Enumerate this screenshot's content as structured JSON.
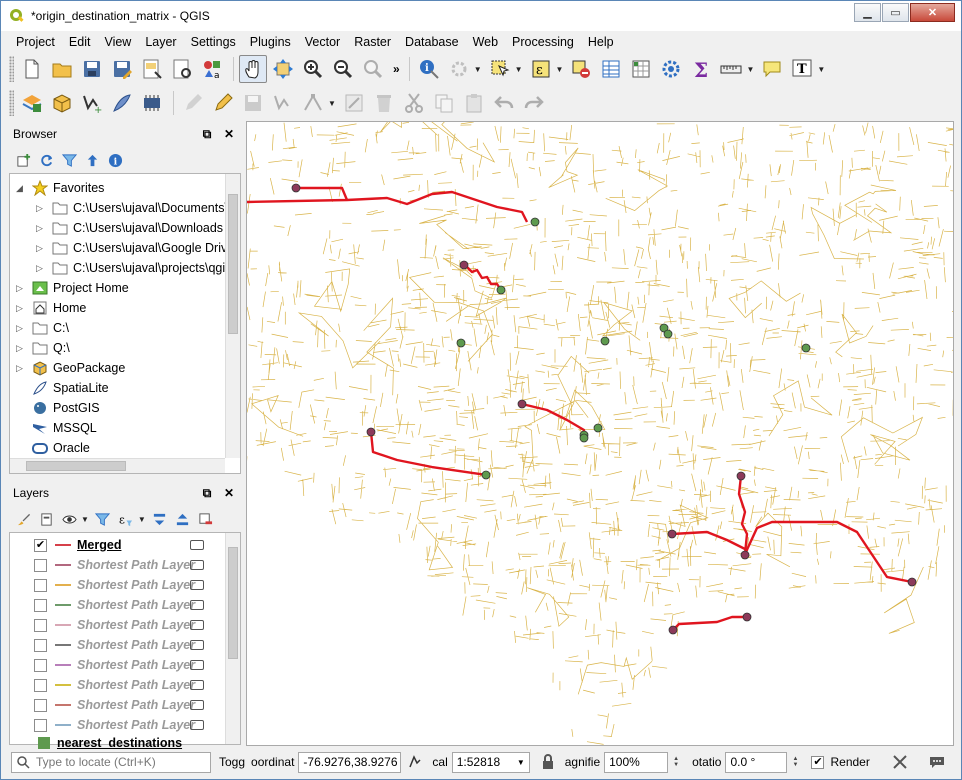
{
  "window": {
    "title": "*origin_destination_matrix - QGIS",
    "min_label": "▁",
    "max_label": "▭",
    "close_label": "✕"
  },
  "menu": [
    "Project",
    "Edit",
    "View",
    "Layer",
    "Settings",
    "Plugins",
    "Vector",
    "Raster",
    "Database",
    "Web",
    "Processing",
    "Help"
  ],
  "toolbar_overflow": "»",
  "browser": {
    "title": "Browser",
    "items": [
      {
        "label": "Favorites",
        "icon": "star-icon",
        "indent": 0,
        "expanded": true
      },
      {
        "label": "C:\\Users\\ujaval\\Documents\\",
        "icon": "folder-icon",
        "indent": 1
      },
      {
        "label": "C:\\Users\\ujaval\\Downloads",
        "icon": "folder-icon",
        "indent": 1
      },
      {
        "label": "C:\\Users\\ujaval\\Google Driv",
        "icon": "folder-icon",
        "indent": 1
      },
      {
        "label": "C:\\Users\\ujaval\\projects\\qgi",
        "icon": "folder-icon",
        "indent": 1
      },
      {
        "label": "Project Home",
        "icon": "project-home-icon",
        "indent": 0
      },
      {
        "label": "Home",
        "icon": "home-icon",
        "indent": 0
      },
      {
        "label": "C:\\",
        "icon": "folder-icon",
        "indent": 0
      },
      {
        "label": "Q:\\",
        "icon": "folder-icon",
        "indent": 0
      },
      {
        "label": "GeoPackage",
        "icon": "geopackage-icon",
        "indent": 0
      },
      {
        "label": "SpatiaLite",
        "icon": "spatialite-icon",
        "indent": 0,
        "leaf": true
      },
      {
        "label": "PostGIS",
        "icon": "postgis-icon",
        "indent": 0,
        "leaf": true
      },
      {
        "label": "MSSQL",
        "icon": "mssql-icon",
        "indent": 0,
        "leaf": true
      },
      {
        "label": "Oracle",
        "icon": "oracle-icon",
        "indent": 0,
        "leaf": true
      }
    ]
  },
  "layers": {
    "title": "Layers",
    "items": [
      {
        "label": "Merged",
        "checked": true,
        "color": "#d6404a"
      },
      {
        "label": "Shortest Path Layer",
        "checked": false,
        "color": "#b2687f"
      },
      {
        "label": "Shortest Path Layer",
        "checked": false,
        "color": "#e3b04d"
      },
      {
        "label": "Shortest Path Layer",
        "checked": false,
        "color": "#6e9b6b"
      },
      {
        "label": "Shortest Path Layer",
        "checked": false,
        "color": "#d8a7b5"
      },
      {
        "label": "Shortest Path Layer",
        "checked": false,
        "color": "#777777"
      },
      {
        "label": "Shortest Path Layer",
        "checked": false,
        "color": "#b87fba"
      },
      {
        "label": "Shortest Path Layer",
        "checked": false,
        "color": "#d4c03f"
      },
      {
        "label": "Shortest Path Layer",
        "checked": false,
        "color": "#c5756d"
      },
      {
        "label": "Shortest Path Layer",
        "checked": false,
        "color": "#8fb0c9"
      }
    ],
    "partial_item": "nearest_destinations"
  },
  "status": {
    "locate_placeholder": "Type to locate (Ctrl+K)",
    "toggle_label": "Togg",
    "coordinate_label": "oordinat",
    "coordinate_value": "-76.9276,38.9276",
    "scale_label": "cal",
    "scale_value": "1:52818",
    "magnifier_label": "agnifie",
    "magnifier_value": "100%",
    "rotation_label": "otatio",
    "rotation_value": "0.0 °",
    "render_label": "Render",
    "render_checked": true
  },
  "colors": {
    "roads": "#d9b44a",
    "route": "#e0151f",
    "origin": "#8c3a5a",
    "destination": "#5e9a4e"
  }
}
